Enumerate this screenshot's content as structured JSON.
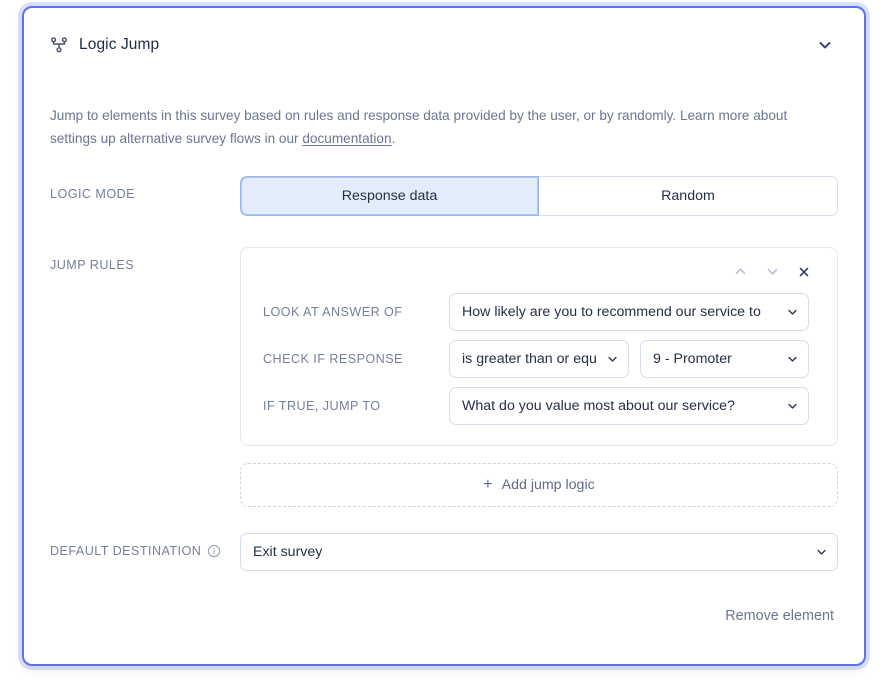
{
  "card": {
    "title": "Logic Jump",
    "icon": "logic-jump-icon",
    "collapse_icon": "chevron-down-icon",
    "accent_color": "#5c72f0",
    "description_part1": "Jump to elements in this survey based on rules and response data provided by the user, or by randomly. Learn more about settings up alternative survey flows in our ",
    "description_link": "documentation",
    "description_part2": "."
  },
  "logic_mode": {
    "label": "LOGIC MODE",
    "options": [
      {
        "label": "Response data",
        "selected": true
      },
      {
        "label": "Random",
        "selected": false
      }
    ],
    "selected_bg": "#e3ecfa"
  },
  "jump_rules": {
    "label": "JUMP RULES",
    "toolbar": {
      "move_up_icon": "chevron-up-icon",
      "move_down_icon": "chevron-down-icon",
      "remove_icon": "close-icon"
    },
    "fields": [
      {
        "label": "LOOK AT ANSWER OF",
        "value": "How likely are you to recommend our service to"
      },
      {
        "label": "CHECK IF RESPONSE",
        "operator_value": "is greater than or equ",
        "comparison_value": "9 - Promoter"
      },
      {
        "label": "IF TRUE, JUMP TO",
        "value": "What do you value most about our service?"
      }
    ],
    "add_button": {
      "label": "Add jump logic",
      "icon": "plus-icon"
    }
  },
  "default_destination": {
    "label": "DEFAULT DESTINATION",
    "info_icon": "info-icon",
    "value": "Exit survey"
  },
  "footer": {
    "remove_label": "Remove element"
  }
}
